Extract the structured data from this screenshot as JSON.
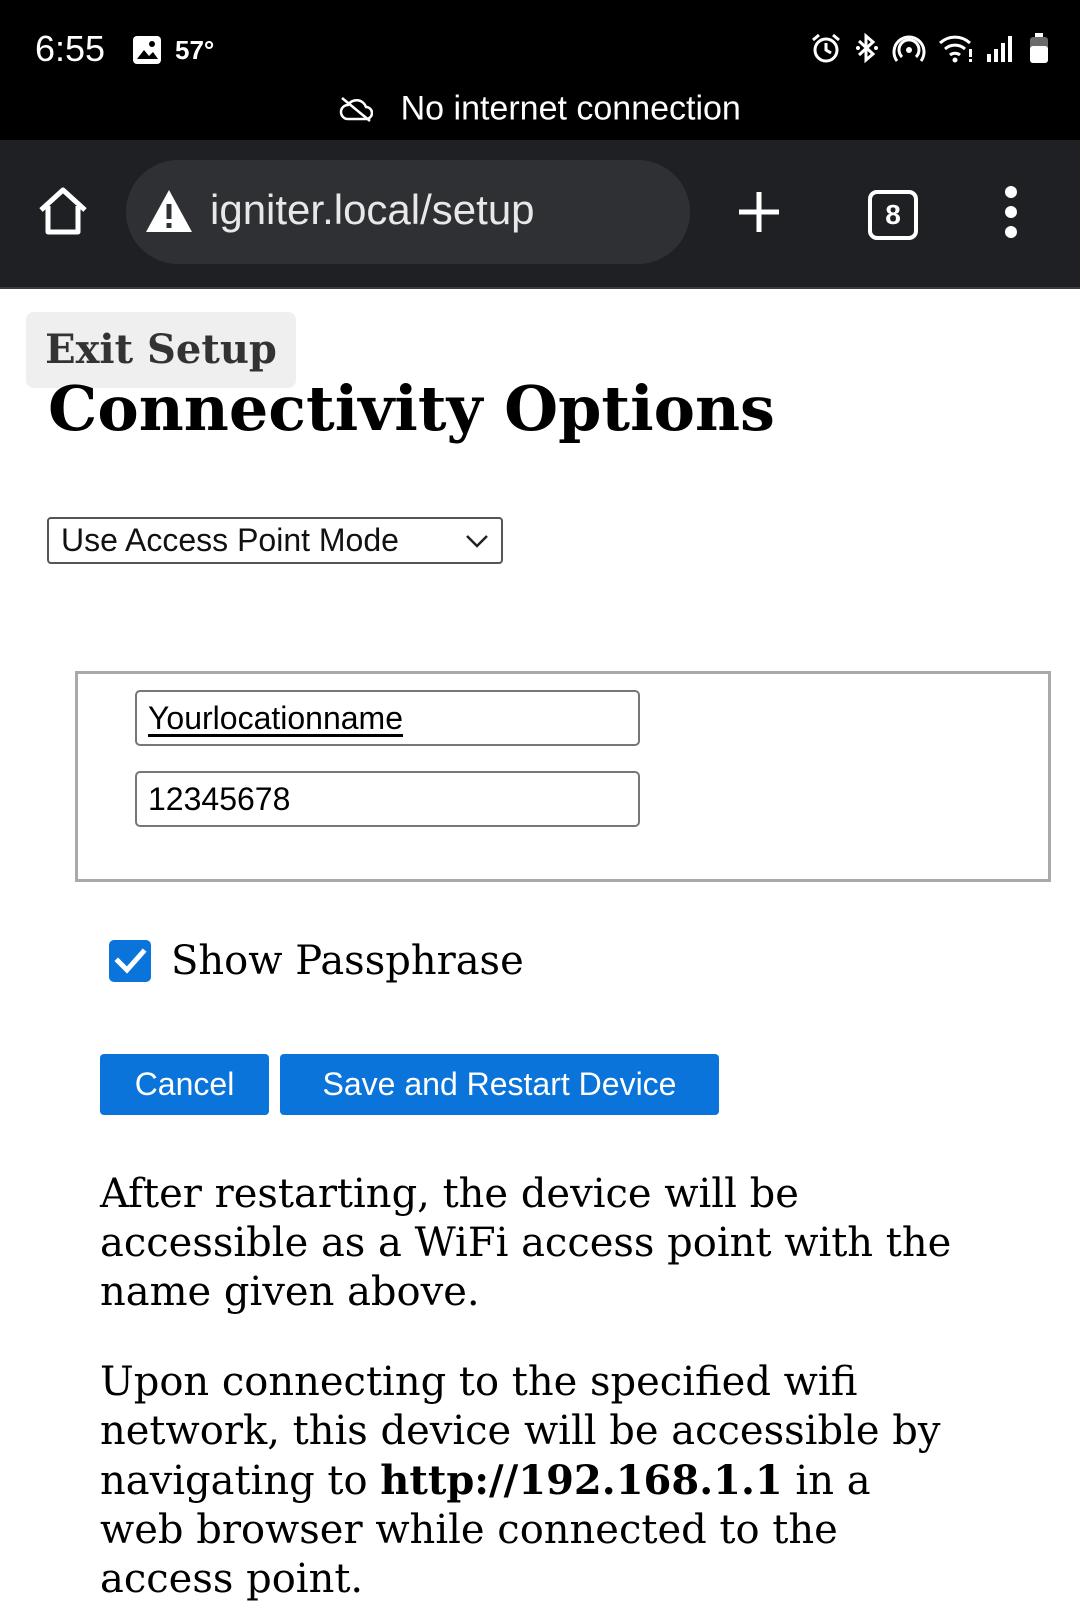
{
  "status_bar": {
    "time": "6:55",
    "temperature": "57°",
    "icons": [
      "photo-icon",
      "alarm-icon",
      "bluetooth-icon",
      "hotspot-icon",
      "wifi-icon",
      "signal-icon",
      "battery-icon"
    ],
    "connection_status": "No internet connection"
  },
  "browser": {
    "url": "igniter.local/setup",
    "tab_count": "8",
    "icons": [
      "home-icon",
      "warning-icon",
      "new-tab-icon",
      "tabs-icon",
      "more-menu-icon"
    ]
  },
  "page": {
    "exit_button": "Exit Setup",
    "title": "Connectivity Options",
    "mode_select": {
      "selected": "Use Access Point Mode"
    },
    "ssid_value": "Yourlocationname",
    "passphrase_value": "12345678",
    "show_passphrase": {
      "label": "Show Passphrase",
      "checked": true
    },
    "buttons": {
      "cancel": "Cancel",
      "save": "Save and Restart Device"
    },
    "info_1": "After restarting, the device will be accessible as a WiFi access point with the name given above.",
    "info_2": {
      "before": "Upon connecting to the specified wifi network, this device will be accessible by navigating to ",
      "url": "http://192.168.1.1",
      "after": " in a web browser while connected to the access point."
    }
  },
  "colors": {
    "accent": "#0b74db",
    "status_bar_bg": "#000000",
    "toolbar_bg": "#1f2023",
    "url_pill_bg": "#2e3034"
  }
}
